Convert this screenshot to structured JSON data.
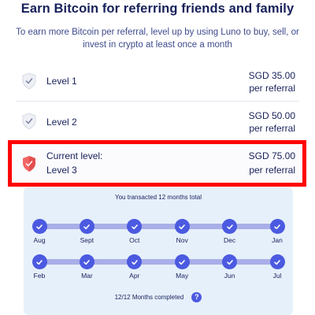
{
  "header": {
    "title": "Earn Bitcoin for referring friends and family",
    "subtitle": "To earn more Bitcoin per referral, level up by using Luno to buy, sell, or invest in crypto at least once a month"
  },
  "levels": [
    {
      "name": "Level 1",
      "amount": "SGD 35.00",
      "per": "per referral"
    },
    {
      "name": "Level 2",
      "amount": "SGD 50.00",
      "per": "per referral"
    },
    {
      "label": "Current level:",
      "name": "Level 3",
      "amount": "SGD 75.00",
      "per": "per referral"
    }
  ],
  "progress": {
    "caption": "You transacted 12 months total",
    "row1": [
      "Aug",
      "Sept",
      "Oct",
      "Nov",
      "Dec",
      "Jan"
    ],
    "row2": [
      "Feb",
      "Mar",
      "Apr",
      "May",
      "Jun",
      "Jul"
    ],
    "completed": "12/12 Months completed",
    "help_glyph": "?"
  },
  "colors": {
    "navy": "#17205a",
    "accent": "#4b5ae0",
    "current_shield": "#f26464",
    "highlight_border": "#ff0000",
    "panel_bg": "#e6f0fb"
  },
  "icons": {
    "level_icon": "shield-check-icon",
    "month_icon": "check-circle-icon",
    "help_icon": "question-circle-icon"
  }
}
